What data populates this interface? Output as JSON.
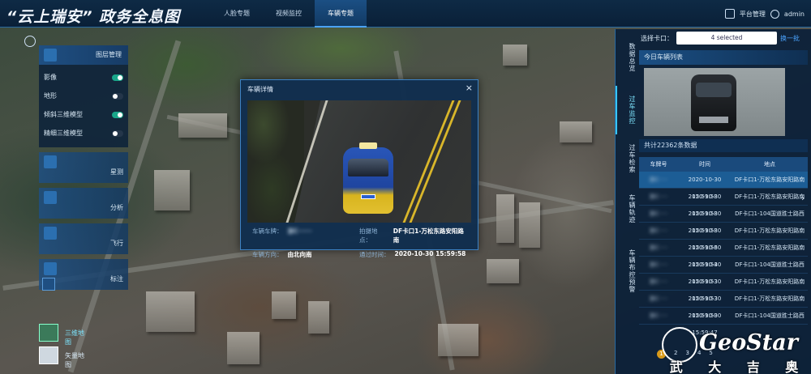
{
  "app": {
    "title": "“云上瑞安” 政务全息图"
  },
  "nav": {
    "items": [
      "人脸专题",
      "视频监控",
      "车辆专题"
    ],
    "active_index": 2
  },
  "topright": {
    "platform_label": "平台管理",
    "user": "admin"
  },
  "layer_panel": {
    "title": "图层管理",
    "layers": [
      {
        "label": "影像",
        "on": true
      },
      {
        "label": "地形",
        "on": false
      },
      {
        "label": "倾斜三维模型",
        "on": true
      },
      {
        "label": "精细三维模型",
        "on": false
      }
    ]
  },
  "tools": [
    "星测",
    "分析",
    "飞行",
    "标注"
  ],
  "basemaps": [
    {
      "label": "三维地图",
      "active": true
    },
    {
      "label": "矢量地图",
      "active": false
    }
  ],
  "modal": {
    "title": "车辆详情",
    "close": "×",
    "fields": {
      "plate_label": "车辆车牌：",
      "plate_value": "浙C······",
      "location_label": "拍摄地点：",
      "location_value": "DF卡口1-万松东路安阳路南",
      "direction_label": "车辆方向：",
      "direction_value": "由北向南",
      "time_label": "通过时间：",
      "time_value": "2020-10-30 15:59:58"
    }
  },
  "right_nav": [
    "数据总览",
    "过车监控",
    "过车检索",
    "车辆轨迹",
    "车辆布控预警"
  ],
  "right_nav_active": 1,
  "right_panel": {
    "select_label": "选择卡口：",
    "select_value": "4 selected",
    "change_label": "换一批",
    "list_title": "今日车辆列表",
    "count_text": "共计22362条数据",
    "columns": [
      "车牌号",
      "时间",
      "地点"
    ],
    "rows": [
      {
        "plate": "浙C·····",
        "time": "2020-10-30 15:59:58",
        "place": "DF卡口1-万松东路安阳路南",
        "selected": true
      },
      {
        "plate": "浙C·····",
        "time": "2020-10-30 15:59:58",
        "place": "DF卡口1-万松东路安阳路南",
        "selected": false
      },
      {
        "plate": "浙C·····",
        "time": "2020-10-30 15:59:58",
        "place": "DF卡口1-104国道胜士路西",
        "selected": false
      },
      {
        "plate": "浙C·····",
        "time": "2020-10-30 15:59:56",
        "place": "DF卡口1-万松东路安阳路南",
        "selected": false
      },
      {
        "plate": "浙C·····",
        "time": "2020-10-30 15:59:54",
        "place": "DF卡口1-万松东路安阳路南",
        "selected": false
      },
      {
        "plate": "浙C·····",
        "time": "2020-10-30 15:59:53",
        "place": "DF卡口1-104国道胜士路西",
        "selected": false
      },
      {
        "plate": "浙C·····",
        "time": "2020-10-30 15:59:53",
        "place": "DF卡口1-万松东路安阳路南",
        "selected": false
      },
      {
        "plate": "浙C·····",
        "time": "2020-10-30 15:59:50",
        "place": "DF卡口1-万松东路安阳路南",
        "selected": false
      },
      {
        "plate": "浙C·····",
        "time": "2020-10-30 15:59:47",
        "place": "DF卡口1-104国道胜士路西",
        "selected": false
      }
    ],
    "pager": [
      "1",
      "2",
      "3",
      "4",
      "5"
    ]
  },
  "logo": {
    "en": "GeoStar",
    "cn": [
      "武",
      "大",
      "吉",
      "奥"
    ]
  },
  "colors": {
    "accent": "#4aa3ff",
    "panel": "#0a2038",
    "active_toggle": "#1aa68a",
    "highlight": "#7ee6ff"
  }
}
